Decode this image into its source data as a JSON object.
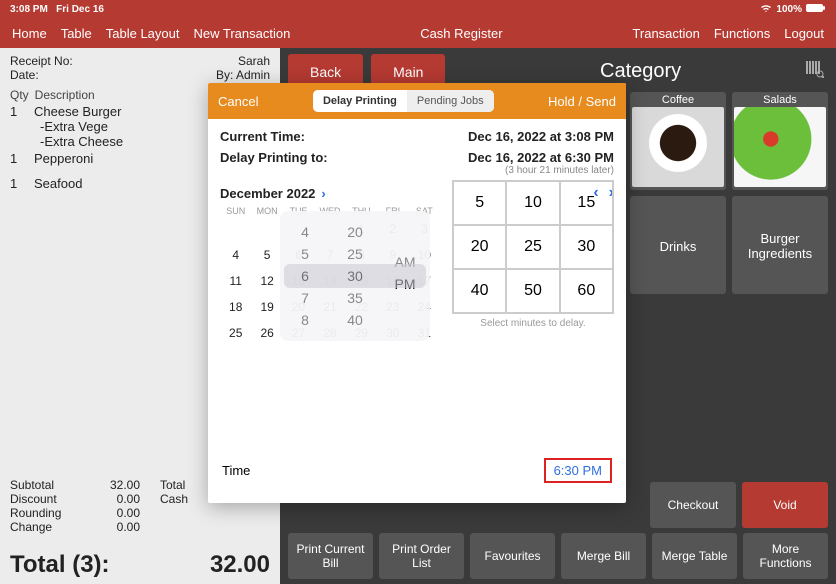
{
  "status": {
    "time": "3:08 PM",
    "day": "Fri Dec 16",
    "battery": "100%"
  },
  "nav": {
    "left": [
      "Home",
      "Table",
      "Table Layout",
      "New Transaction"
    ],
    "center": "Cash Register",
    "right": [
      "Transaction",
      "Functions",
      "Logout"
    ]
  },
  "receipt": {
    "receipt_no_label": "Receipt No:",
    "server": "Sarah",
    "date_label": "Date:",
    "by_label": "By:",
    "by_value": "Admin",
    "columns": {
      "qty": "Qty",
      "desc": "Description"
    },
    "items": [
      {
        "qty": "1",
        "desc": "Cheese Burger",
        "mods": [
          "-Extra Vege",
          "-Extra Cheese"
        ]
      },
      {
        "qty": "1",
        "desc": "Pepperoni",
        "mods": []
      },
      {
        "qty": "1",
        "desc": "Seafood",
        "mods": []
      }
    ],
    "subtotal_label": "Subtotal",
    "subtotal": "32.00",
    "discount_label": "Discount",
    "discount": "0.00",
    "rounding_label": "Rounding",
    "rounding": "0.00",
    "change_label": "Change",
    "change": "0.00",
    "total_col2_label": "Total",
    "cash_label": "Cash",
    "grand_label": "Total (3):",
    "grand_value": "32.00"
  },
  "buttons": {
    "back": "Back",
    "main": "Main",
    "checkout": "Checkout",
    "void": "Void",
    "print_current": "Print Current Bill",
    "print_order_list": "Print Order List",
    "favourites": "Favourites",
    "merge_bill": "Merge Bill",
    "merge_table": "Merge Table",
    "more": "More Functions"
  },
  "categories": {
    "header": "Category",
    "coffee": "Coffee",
    "salads": "Salads",
    "drinks": "Drinks",
    "burger": "Burger Ingredients"
  },
  "modal": {
    "cancel": "Cancel",
    "seg_delay": "Delay Printing",
    "seg_pending": "Pending Jobs",
    "hold_send": "Hold / Send",
    "current_time_label": "Current Time:",
    "current_time_value": "Dec 16, 2022 at 3:08 PM",
    "delay_to_label": "Delay Printing to:",
    "delay_to_value": "Dec 16, 2022 at 6:30 PM",
    "later_note": "(3 hour 21 minutes later)",
    "month": "December 2022",
    "dow": [
      "SUN",
      "MON",
      "TUE",
      "WED",
      "THU",
      "FRI",
      "SAT"
    ],
    "weeks": [
      [
        "",
        "",
        "",
        "",
        "1",
        "2",
        "3"
      ],
      [
        "4",
        "5",
        "6",
        "7",
        "8",
        "9",
        "10"
      ],
      [
        "11",
        "12",
        "13",
        "14",
        "15",
        "16",
        "17"
      ],
      [
        "18",
        "19",
        "20",
        "21",
        "22",
        "23",
        "24"
      ],
      [
        "25",
        "26",
        "27",
        "28",
        "29",
        "30",
        "31"
      ]
    ],
    "picker": {
      "hours": [
        "4",
        "5",
        "6",
        "7",
        "8"
      ],
      "minutes": [
        "20",
        "25",
        "30",
        "35",
        "40"
      ],
      "ampm": [
        "AM",
        "PM"
      ],
      "selected_hour": "6",
      "selected_min": "30",
      "selected_ampm": "PM"
    },
    "delay_grid": [
      "5",
      "10",
      "15",
      "20",
      "25",
      "30",
      "40",
      "50",
      "60"
    ],
    "delay_grid_note": "Select minutes to delay.",
    "time_label": "Time",
    "time_value": "6:30 PM"
  }
}
